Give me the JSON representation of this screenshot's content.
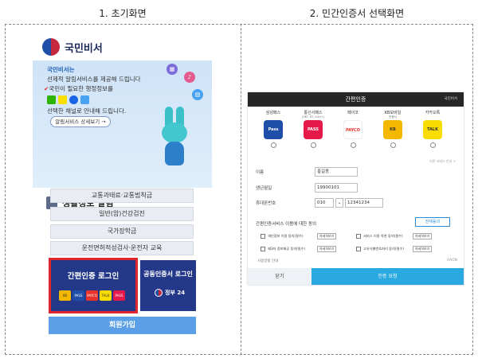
{
  "captions": {
    "left": "1. 초기화면",
    "right": "2. 민간인증서 선택화면"
  },
  "left": {
    "brand": "국민비서",
    "hero": {
      "line1": "국민비서는",
      "line2": "선제적 알림서비스를 제공해 드립니다",
      "line3": "국민이 필요한 행정정보를",
      "line4": "선택한 채널로 안내해 드립니다.",
      "detail_button": "알림서비스 상세보기 →"
    },
    "life_title": "생활정보 알림",
    "menu": [
      "교통과태료·교통범칙금",
      "일반(암)건강검진",
      "국가장학금",
      "운전면허적성검사·운전자 교육"
    ],
    "easy_login": "간편인증 로그인",
    "easy_logos": [
      "KB",
      "PASS",
      "PAYCO",
      "TALK",
      "PASS"
    ],
    "cert_login": "공동인증서 로그인",
    "gov24": "정부 24",
    "join": "회원가입"
  },
  "right": {
    "title": "간편인증",
    "brand": "국민비서",
    "providers": [
      {
        "name": "삼성패스",
        "sub": "",
        "logo": "Pass",
        "color": "#1f4ea8"
      },
      {
        "name": "통신사패스",
        "sub": "(SKT, KT, LGU+)",
        "logo": "PASS",
        "color": "#e6194b"
      },
      {
        "name": "페이코",
        "sub": "",
        "logo": "PAYCO",
        "color": "#e8332a"
      },
      {
        "name": "KB모바일",
        "sub": "인증서",
        "logo": "KB",
        "color": "#f5b800"
      },
      {
        "name": "카카오톡",
        "sub": "",
        "logo": "TALK",
        "color": "#f9dc00"
      }
    ],
    "more": "다른 서비스 안내 >",
    "fields": [
      {
        "label": "이름",
        "value": "홍길동"
      },
      {
        "label": "생년월일",
        "value": "19900101"
      },
      {
        "label": "휴대폰번호",
        "prefix": "010",
        "value": "12341234"
      }
    ],
    "consent_title": "간편인증서비스 이용에 대한 동의",
    "agree_all": "전체동의",
    "consents": [
      {
        "text": "개인정보 이용 동의(필수)",
        "view": "자세히보기"
      },
      {
        "text": "서비스 이용 약관 동의(필수)",
        "view": "자세히보기"
      },
      {
        "text": "제3자 정보제공 동의(필수)",
        "view": "자세히보기"
      },
      {
        "text": "고유식별번호처리 동의(필수)",
        "view": "자세히보기"
      }
    ],
    "guide": "사용방법 안내",
    "raon": "RAON",
    "close": "닫기",
    "request": "인증 요청"
  }
}
